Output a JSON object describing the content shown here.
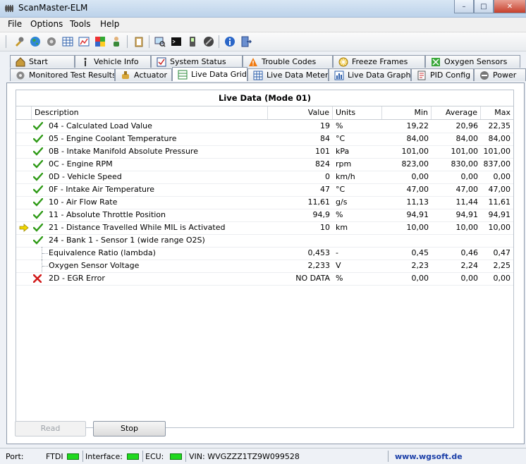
{
  "window": {
    "title": "ScanMaster-ELM",
    "buttons": {
      "minimize": "–",
      "maximize": "□",
      "close": "✕"
    }
  },
  "menu": [
    "File",
    "Options",
    "Tools",
    "Help"
  ],
  "tabs_row1": [
    "Start",
    "Vehicle Info",
    "System Status",
    "Trouble Codes",
    "Freeze Frames",
    "Oxygen Sensors"
  ],
  "tabs_row2": [
    "Monitored Test Results",
    "Actuator",
    "Live Data Grid",
    "Live Data Meter",
    "Live Data Graph",
    "PID Config",
    "Power"
  ],
  "active_tab": "Live Data Grid",
  "grid": {
    "title": "Live Data (Mode 01)",
    "columns": {
      "description": "Description",
      "value": "Value",
      "units": "Units",
      "min": "Min",
      "average": "Average",
      "max": "Max"
    },
    "rows": [
      {
        "status": "ok",
        "description": "04 - Calculated Load Value",
        "value": "19",
        "units": "%",
        "min": "19,22",
        "average": "20,96",
        "max": "22,35"
      },
      {
        "status": "ok",
        "description": "05 - Engine Coolant Temperature",
        "value": "84",
        "units": "°C",
        "min": "84,00",
        "average": "84,00",
        "max": "84,00"
      },
      {
        "status": "ok",
        "description": "0B - Intake Manifold Absolute Pressure",
        "value": "101",
        "units": "kPa",
        "min": "101,00",
        "average": "101,00",
        "max": "101,00"
      },
      {
        "status": "ok",
        "description": "0C - Engine RPM",
        "value": "824",
        "units": "rpm",
        "min": "823,00",
        "average": "830,00",
        "max": "837,00"
      },
      {
        "status": "ok",
        "description": "0D - Vehicle Speed",
        "value": "0",
        "units": "km/h",
        "min": "0,00",
        "average": "0,00",
        "max": "0,00"
      },
      {
        "status": "ok",
        "description": "0F - Intake Air Temperature",
        "value": "47",
        "units": "°C",
        "min": "47,00",
        "average": "47,00",
        "max": "47,00"
      },
      {
        "status": "ok",
        "description": "10 - Air Flow Rate",
        "value": "11,61",
        "units": "g/s",
        "min": "11,13",
        "average": "11,44",
        "max": "11,61"
      },
      {
        "status": "ok",
        "description": "11 - Absolute Throttle Position",
        "value": "94,9",
        "units": "%",
        "min": "94,91",
        "average": "94,91",
        "max": "94,91"
      },
      {
        "status": "ok",
        "current": true,
        "description": "21 - Distance Travelled While MIL is Activated",
        "value": "10",
        "units": "km",
        "min": "10,00",
        "average": "10,00",
        "max": "10,00"
      },
      {
        "status": "ok",
        "description": "24 - Bank 1 - Sensor 1 (wide range O2S)",
        "value": "",
        "units": "",
        "min": "",
        "average": "",
        "max": ""
      },
      {
        "status": "child",
        "description": "Equivalence Ratio (lambda)",
        "value": "0,453",
        "units": "-",
        "min": "0,45",
        "average": "0,46",
        "max": "0,47"
      },
      {
        "status": "child",
        "description": "Oxygen Sensor Voltage",
        "value": "2,233",
        "units": "V",
        "min": "2,23",
        "average": "2,24",
        "max": "2,25"
      },
      {
        "status": "error",
        "description": "2D - EGR Error",
        "value": "NO DATA",
        "units": "%",
        "min": "0,00",
        "average": "0,00",
        "max": "0,00"
      }
    ]
  },
  "buttons": {
    "read": "Read",
    "stop": "Stop"
  },
  "status": {
    "port_label": "Port:",
    "port_value": "FTDI",
    "interface_label": "Interface:",
    "ecu_label": "ECU:",
    "vin": "VIN: WVGZZZ1TZ9W099528",
    "website": "www.wgsoft.de"
  },
  "colors": {
    "ok": "#2e9a16",
    "error": "#d11a1a",
    "led": "#1fd81f",
    "arrow": "#f2d600",
    "link": "#1b3fa8"
  }
}
